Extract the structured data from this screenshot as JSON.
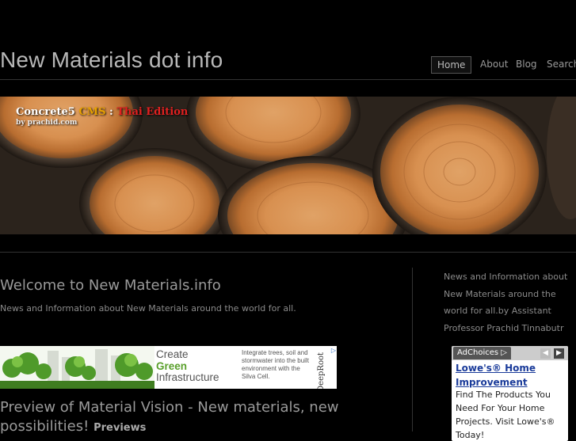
{
  "header": {
    "site_title": "New Materials dot info",
    "nav": [
      {
        "label": "Home",
        "active": true
      },
      {
        "label": "About"
      },
      {
        "label": "Blog"
      },
      {
        "label": "Search"
      }
    ]
  },
  "banner": {
    "brand": "Concrete5",
    "cms": "CMS",
    "separator": ":",
    "edition": "Thai Edition",
    "byline": "by prachid.com"
  },
  "main": {
    "welcome_title": "Welcome to New Materials.info",
    "welcome_desc": "News and Information about New Materials around the world for all.",
    "ad": {
      "title_line1": "Create",
      "title_line2": "Green",
      "title_line3": "Infrastructure",
      "body": "Integrate trees, soil and stormwater into the built environment with the Silva Cell.",
      "brand": "DeepRoot"
    },
    "post_title": "Preview of Material Vision - New materials, new possibilities!",
    "post_tag": "Previews"
  },
  "sidebar": {
    "text": "News and Information about New Materials around the world for all.by Assistant Professor Prachid Tinnabutr",
    "ad": {
      "adchoices": "AdChoices",
      "heading_line1": "Lowe's® Home",
      "heading_line2": "Improvement",
      "body": "Find The Products You Need For Your Home Projects. Visit Lowe's® Today!"
    }
  },
  "colors": {
    "background": "#000000",
    "ad_link": "#1a3b9a",
    "accent_cms": "#e8a200",
    "accent_thai": "#e02020",
    "ad_green": "#5aa02c"
  }
}
